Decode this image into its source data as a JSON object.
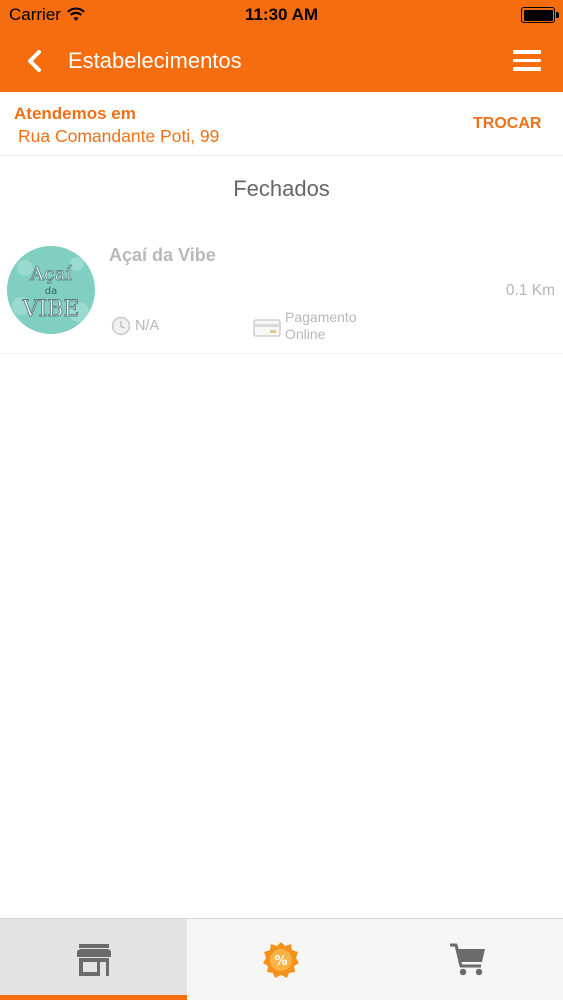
{
  "status_bar": {
    "carrier": "Carrier",
    "time": "11:30 AM"
  },
  "header": {
    "title": "Estabelecimentos",
    "back_icon": "chevron-left-icon",
    "menu_icon": "hamburger-menu-icon"
  },
  "location": {
    "label": "Atendemos em",
    "address": "Rua Comandante Poti, 99",
    "change_label": "TROCAR"
  },
  "section": {
    "title": "Fechados"
  },
  "stores": [
    {
      "name": "Açaí da Vibe",
      "logo_text": {
        "line1": "Açaí",
        "line2": "da",
        "line3": "VIBE"
      },
      "distance": "0.1 Km",
      "delivery_time": "N/A",
      "payment_line1": "Pagamento",
      "payment_line2": "Online"
    }
  ],
  "tabbar": {
    "tabs": [
      {
        "icon": "store-icon",
        "active": true
      },
      {
        "icon": "discount-badge-icon",
        "active": false
      },
      {
        "icon": "cart-icon",
        "active": false
      }
    ]
  },
  "colors": {
    "brand": "#f56d0f",
    "muted_text": "#b8b8b8",
    "section_text": "#666666"
  }
}
